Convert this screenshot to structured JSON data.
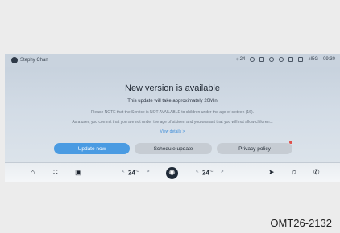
{
  "status_bar": {
    "user_name": "Stephy Chan",
    "temperature": "☼24",
    "network": ".ıl5G",
    "time": "09:30"
  },
  "dialog": {
    "title": "New version is available",
    "subtitle": "This update will take approximately 20Min",
    "note1": "Please NOTE that the Service is NOT AVAILABLE to children under the age of sixteen (16).",
    "note2": "As a user, you commit that you are not under the age of sixteen and you warrant that you will not allow children...",
    "details_link": "View details >",
    "buttons": {
      "update": "Update now",
      "schedule": "Schedule update",
      "privacy": "Privacy policy"
    }
  },
  "dock": {
    "left_temp": "24",
    "right_temp": "24",
    "temp_unit": "°C",
    "left_arrow": "<",
    "right_arrow": ">"
  },
  "figure_code": "OMT26-2132",
  "colors": {
    "accent": "#4a9be2",
    "link": "#3e8ed9",
    "notification_dot": "#e0504a"
  }
}
